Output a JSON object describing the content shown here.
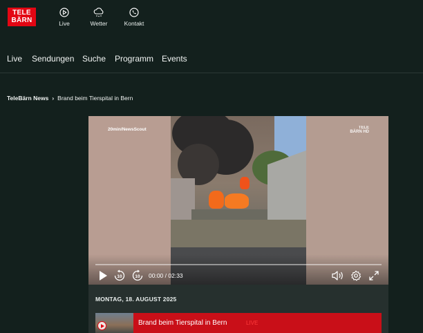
{
  "header": {
    "logo": {
      "line1": "TELE",
      "line2": "BÄRN"
    },
    "topnav": [
      {
        "label": "Live",
        "icon": "play-circle-icon"
      },
      {
        "label": "Wetter",
        "icon": "weather-cloud-icon"
      },
      {
        "label": "Kontakt",
        "icon": "phone-icon"
      }
    ],
    "mainnav": [
      "Live",
      "Sendungen",
      "Suche",
      "Programm",
      "Events"
    ]
  },
  "breadcrumb": {
    "root": "TeleBärn News",
    "current": "Brand beim Tierspital in Bern"
  },
  "player": {
    "watermark_source": "20min/NewsScout",
    "watermark_logo_line1": "TELE",
    "watermark_logo_line2": "BÄRN HD",
    "current_time": "00:00",
    "duration": "02:33",
    "time_separator": " / ",
    "progress": 0,
    "icons": {
      "play": "play-icon",
      "rewind": "rewind-10-icon",
      "forward": "forward-10-icon",
      "volume": "volume-icon",
      "settings": "settings-gear-icon",
      "fullscreen": "fullscreen-icon"
    }
  },
  "info": {
    "date": "MONTAG, 18. AUGUST 2025",
    "playlist": [
      {
        "title": "Brand beim Tierspital in Bern",
        "badge": "LIVE"
      }
    ]
  },
  "colors": {
    "background": "#13201d",
    "brand_red": "#e30613",
    "panel": "#26302e",
    "playlist_active": "#c90f18"
  }
}
